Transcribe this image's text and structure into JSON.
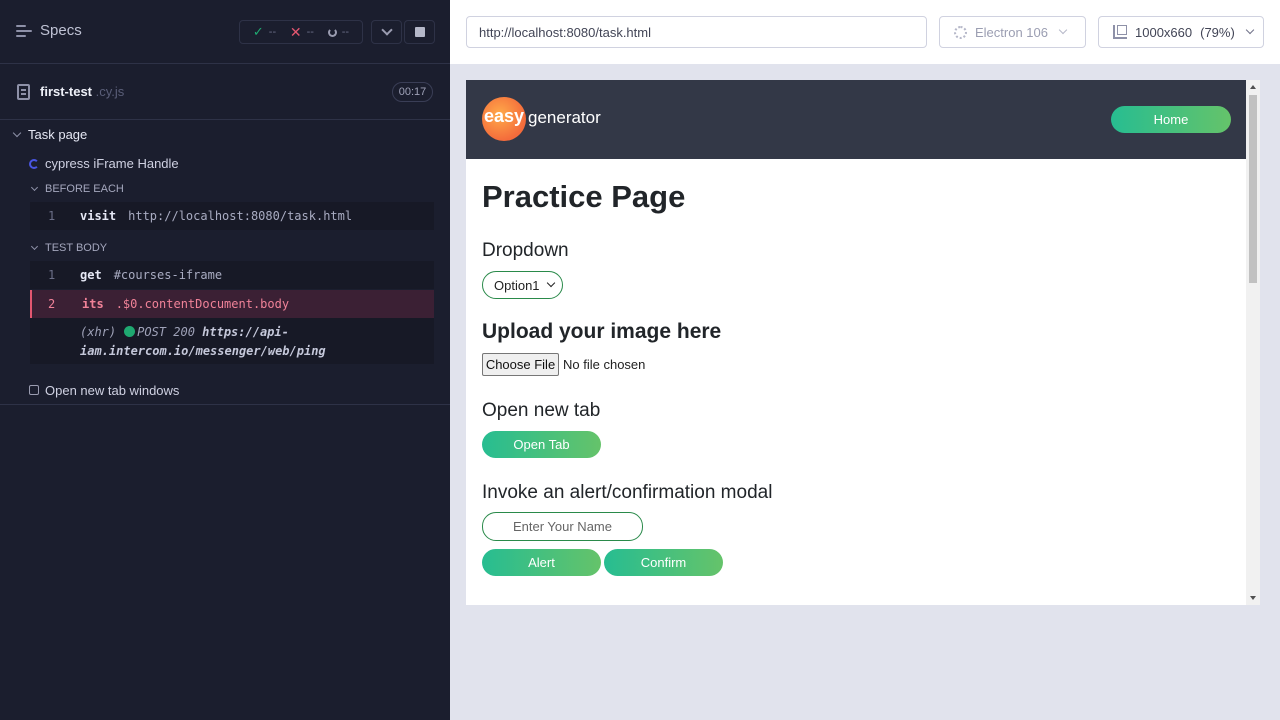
{
  "reporter": {
    "specs_label": "Specs",
    "stats": {
      "passed": "--",
      "failed": "--",
      "pending": "--"
    },
    "spec": {
      "name": "first-test",
      "ext": ".cy.js",
      "duration": "00:17"
    },
    "suite_title": "Task page",
    "test_title": "cypress iFrame Handle",
    "before_each_label": "BEFORE EACH",
    "before_each_commands": [
      {
        "num": "1",
        "name": "visit",
        "arg": "http://localhost:8080/task.html"
      }
    ],
    "test_body_label": "TEST BODY",
    "test_body_commands": [
      {
        "num": "1",
        "name": "get",
        "arg": "#courses-iframe"
      },
      {
        "num": "2",
        "name": "its",
        "arg": ".$0.contentDocument.body"
      }
    ],
    "xhr": {
      "kind": "(xhr)",
      "method_status": "POST 200",
      "url_line1": "https://api-",
      "url_line2": "iam.intercom.io/messenger/web/ping"
    },
    "next_test_title": "Open new tab windows"
  },
  "topbar": {
    "url": "http://localhost:8080/task.html",
    "browser": "Electron 106",
    "viewport": "1000x660",
    "zoom": "(79%)"
  },
  "aut": {
    "logo_easy": "easy",
    "logo_generator": "generator",
    "home_button": "Home",
    "page_title": "Practice Page",
    "dropdown_label": "Dropdown",
    "dropdown_value": "Option1",
    "upload_label": "Upload your image here",
    "choose_file": "Choose File",
    "no_file": "No file chosen",
    "open_tab_label": "Open new tab",
    "open_tab_button": "Open Tab",
    "alert_label": "Invoke an alert/confirmation modal",
    "name_placeholder": "Enter Your Name",
    "alert_button": "Alert",
    "confirm_button": "Confirm"
  },
  "colors": {
    "passed": "#1fa971",
    "failed": "#e45770",
    "running": "#4956e3",
    "brand_gradient_start": "#27bd91",
    "brand_gradient_end": "#65c36a"
  }
}
